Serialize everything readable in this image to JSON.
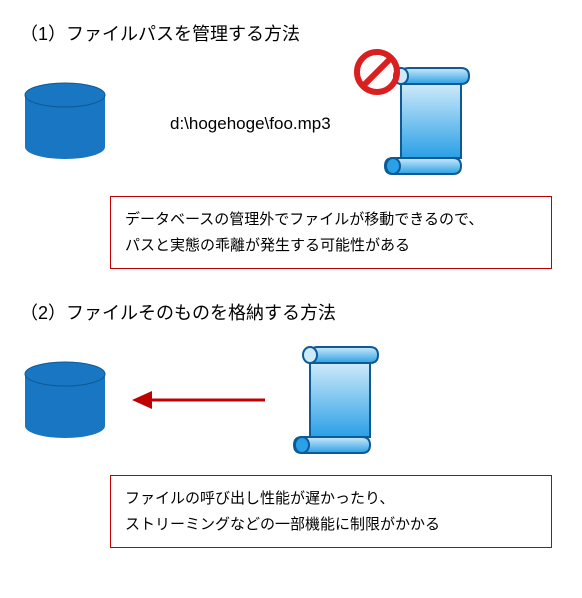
{
  "section1": {
    "heading": "（1）ファイルパスを管理する方法",
    "path": "d:\\hogehoge\\foo.mp3",
    "note_line1": "データベースの管理外でファイルが移動できるので、",
    "note_line2": "パスと実態の乖離が発生する可能性がある"
  },
  "section2": {
    "heading": "（2）ファイルそのものを格納する方法",
    "note_line1": "ファイルの呼び出し性能が遅かったり、",
    "note_line2": "ストリーミングなどの一部機能に制限がかかる"
  },
  "colors": {
    "db_blue": "#1976c2",
    "scroll_grad_top": "#cdeaf9",
    "scroll_grad_bottom": "#2aa0e6",
    "note_border": "#c00000",
    "arrow": "#c00000",
    "prohibit": "#d92020"
  }
}
